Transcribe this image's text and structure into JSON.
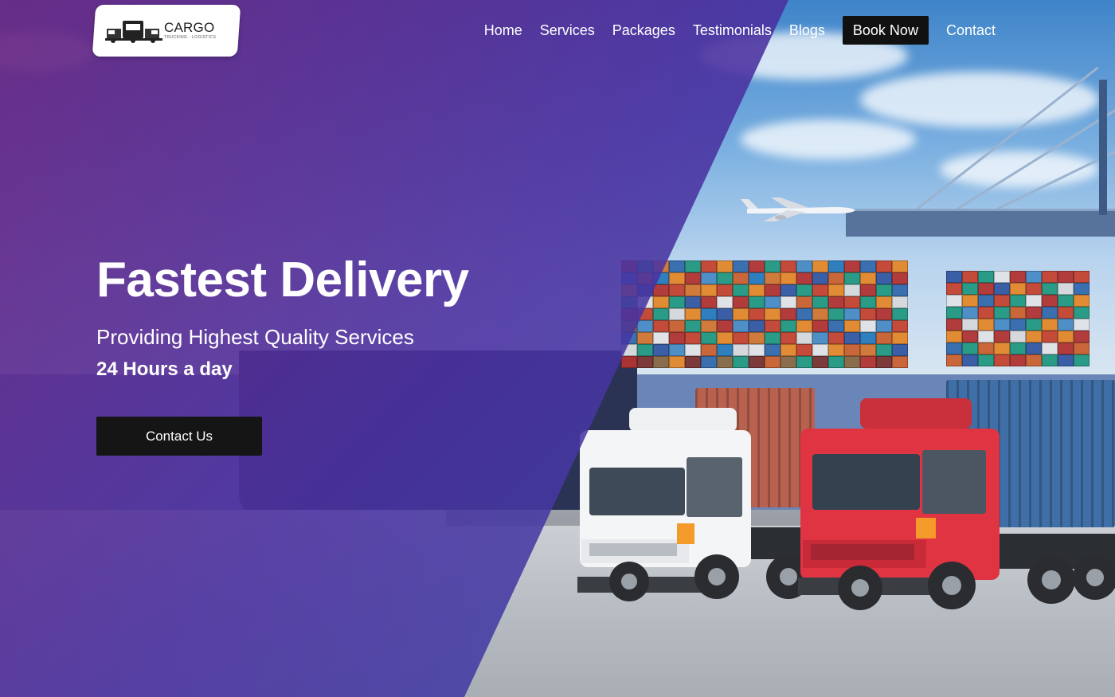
{
  "brand": {
    "name": "CARGO",
    "tagline": "TRUCKING - LOGISTICS"
  },
  "nav": {
    "items": [
      "Home",
      "Services",
      "Packages",
      "Testimonials",
      "Blogs"
    ],
    "book_label": "Book Now",
    "contact_label": "Contact"
  },
  "hero": {
    "title": "Fastest Delivery",
    "subtitle": "Providing Highest Quality Services",
    "hours": "24 Hours a day",
    "cta_label": "Contact Us"
  },
  "colors": {
    "overlay_start": "#6a2682",
    "overlay_end": "#3450ac",
    "button_bg": "#151515",
    "text": "#ffffff"
  },
  "icons": [
    "truck-logo-icon",
    "airplane-icon",
    "truck-white-icon",
    "truck-red-icon"
  ]
}
